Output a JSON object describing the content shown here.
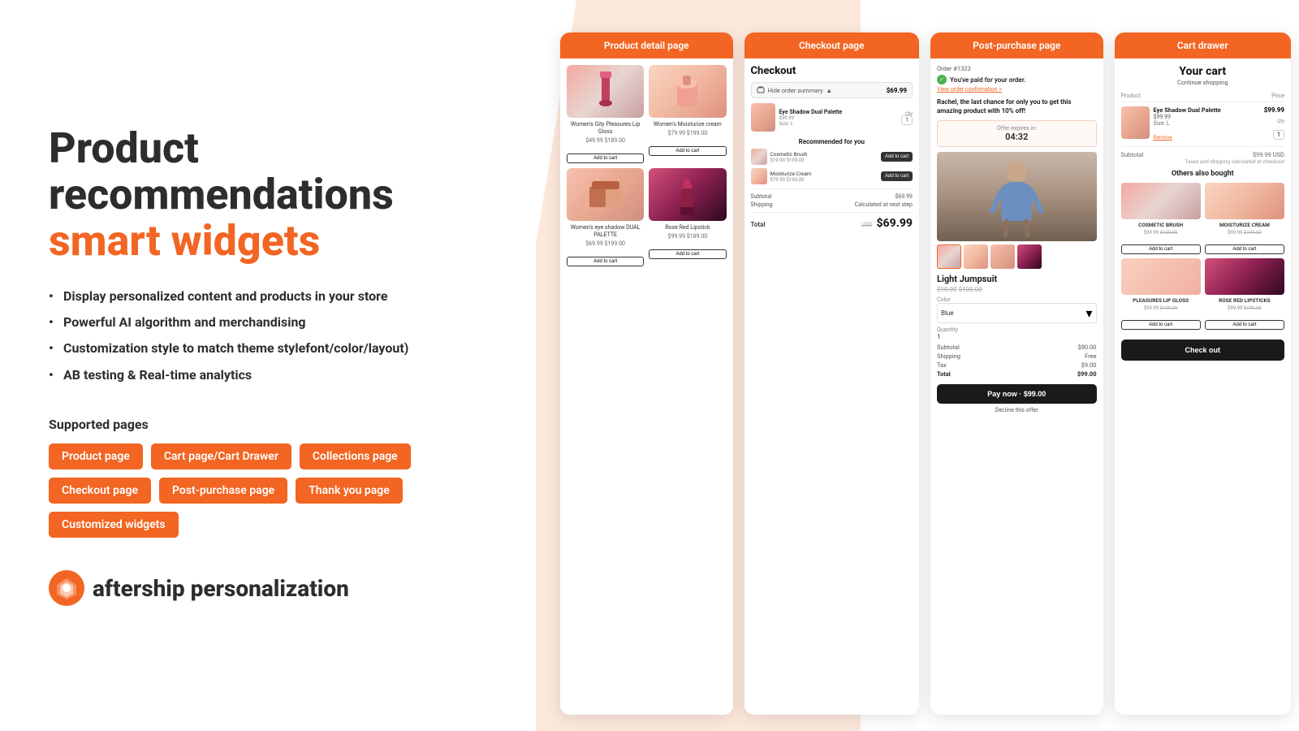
{
  "hero": {
    "title_line1": "Product",
    "title_line2": "recommendations",
    "title_line3": "smart widgets"
  },
  "features": [
    "Display personalized content and products in your store",
    "Powerful AI algorithm and merchandising",
    "Customization style to match theme stylefont/color/layout)",
    "AB testing & Real-time analytics"
  ],
  "supported_pages_label": "Supported pages",
  "tags": [
    "Product page",
    "Cart page/Cart Drawer",
    "Collections page",
    "Checkout page",
    "Post-purchase page",
    "Thank you page",
    "Customized widgets"
  ],
  "logo": {
    "brand": "aftership",
    "suffix": "personalization"
  },
  "screens": {
    "product_detail": {
      "header": "Product detail page",
      "products": [
        {
          "name": "Women's Gity Pleasures Lip Gloss",
          "price": "$49.99",
          "original": "$189.00"
        },
        {
          "name": "Women's Moisturize cream",
          "price": "$79.99",
          "original": "$199.00"
        },
        {
          "name": "Women's eye shadow DUAL PALETTE",
          "price": "$69.99",
          "original": "$199.00"
        },
        {
          "name": "Rose Red Lipstick",
          "price": "$99.99",
          "original": "$189.00"
        }
      ],
      "add_to_cart_label": "Add to cart"
    },
    "checkout": {
      "header": "Checkout page",
      "title": "Checkout",
      "hide_order_summary": "Hide order summary",
      "order_total": "$69.99",
      "item": {
        "name": "Eye Shadow Dual Palette",
        "price": "$99.99",
        "size": "Size: L",
        "qty_label": "Qty",
        "qty": "1"
      },
      "recommended_label": "Recommended for you",
      "rec_items": [
        {
          "name": "Cosmetic Brush",
          "price": "$19.99",
          "original": "$199.00",
          "btn": "Add to cart"
        },
        {
          "name": "Moisturize Cream",
          "price": "$79.99",
          "original": "$190.00",
          "btn": "Add to cart"
        }
      ],
      "subtotal_label": "Subtotal",
      "subtotal_val": "$69.99",
      "shipping_label": "Shipping",
      "shipping_val": "Calculated at next step",
      "total_label": "Total",
      "total_original": "USD",
      "total_val": "$69.99"
    },
    "post_purchase": {
      "header": "Post-purchase page",
      "order_num": "Order #1323",
      "paid_text": "You've paid for your order.",
      "view_order": "View order confirmation >",
      "last_chance": "Rachel, the last chance for only you to get this amazing product with 10% off!",
      "offer_label": "Offer expires in: 04:32",
      "product_name": "Light Jumpsuit",
      "product_price": "$90.00",
      "product_original": "$100.00",
      "color_label": "Color",
      "color_val": "Blue",
      "qty_label": "Quantity",
      "qty_val": "1",
      "subtotal_label": "Subtotal",
      "subtotal_val": "$90.00",
      "shipping_label": "Shipping",
      "shipping_val": "Free",
      "tax_label": "Tax",
      "tax_val": "$9.00",
      "total_label": "Total",
      "total_val": "$99.00",
      "pay_btn": "Pay now · $99.00",
      "decline_link": "Decline this offer"
    },
    "cart_drawer": {
      "header": "Cart drawer",
      "cart_title": "Your cart",
      "continue_shopping": "Continue shopping",
      "product_col": "Product",
      "price_col": "Price",
      "item": {
        "name": "Eye Shadow Dual Palette",
        "price": "$99.99",
        "size": "Size: L",
        "qty": "1",
        "total": "$99.99",
        "remove": "Remove"
      },
      "subtotal_label": "Subtotal",
      "subtotal_val": "$99.99 USD",
      "tax_note": "Taxes and shipping calculated at checkout",
      "also_bought_title": "Others also bought",
      "also_bought": [
        {
          "name": "COSMETIC BRUSH",
          "price": "$99.99",
          "original": "$199.00",
          "btn": "Add to cart"
        },
        {
          "name": "MOISTURIZE CREAM",
          "price": "$99.99",
          "original": "$199.00",
          "btn": "Add to cart"
        },
        {
          "name": "PLEASURES LIP GLOSS",
          "price": "$99.99",
          "original": "$199.00",
          "btn": "Add to cart"
        },
        {
          "name": "ROSE RED LIPSTICKS",
          "price": "$99.99",
          "original": "$190.00",
          "btn": "Add to cart"
        }
      ],
      "checkout_btn": "Check out"
    }
  }
}
